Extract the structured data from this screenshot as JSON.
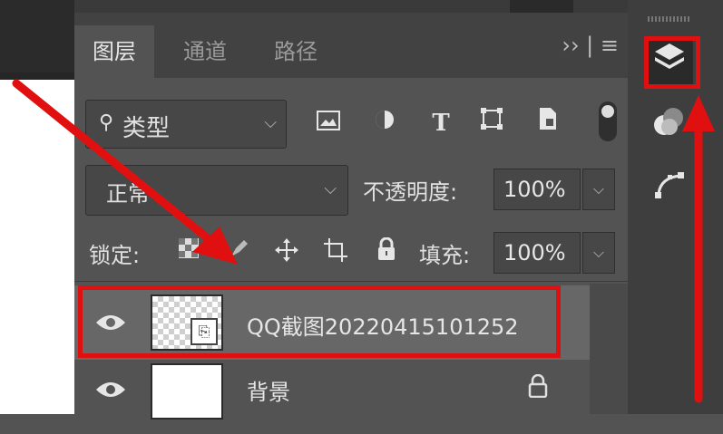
{
  "tabs": [
    {
      "label": "图层",
      "active": true
    },
    {
      "label": "通道",
      "active": false
    },
    {
      "label": "路径",
      "active": false
    }
  ],
  "tab_menu": "›› | ≡",
  "filter": {
    "label": "类型",
    "icon": "search-icon"
  },
  "filter_icons": [
    "image-filter-icon",
    "adjustment-filter-icon",
    "type-filter-icon",
    "shape-filter-icon",
    "smart-object-filter-icon"
  ],
  "blend_mode": "正常",
  "opacity": {
    "label": "不透明度:",
    "value": "100%"
  },
  "lock": {
    "label": "锁定:"
  },
  "fill": {
    "label": "填充:",
    "value": "100%"
  },
  "layers": [
    {
      "name": "QQ截图20220415101252",
      "selected": true,
      "locked": false
    },
    {
      "name": "背景",
      "selected": false,
      "locked": true
    }
  ],
  "right_bar": [
    "layers-panel-icon",
    "channels-panel-icon",
    "paths-panel-icon"
  ],
  "colors": {
    "panel": "#535353",
    "selected_row": "#676767",
    "highlight": "#e01010"
  }
}
